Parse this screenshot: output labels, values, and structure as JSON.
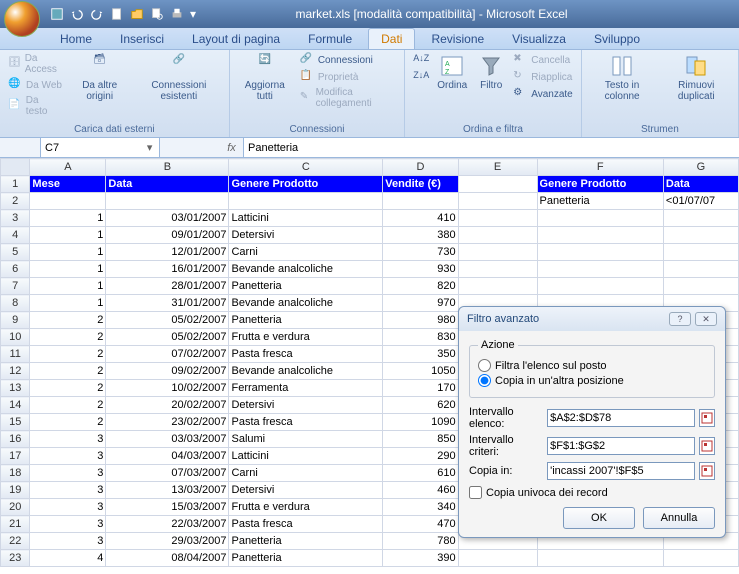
{
  "title": "market.xls [modalità compatibilità] - Microsoft Excel",
  "tabs": [
    "Home",
    "Inserisci",
    "Layout di pagina",
    "Formule",
    "Dati",
    "Revisione",
    "Visualizza",
    "Sviluppo"
  ],
  "active_tab": 4,
  "ribbon": {
    "g1": {
      "label": "Carica dati esterni",
      "items": [
        "Da Access",
        "Da Web",
        "Da testo"
      ],
      "btns": [
        "Da altre origini",
        "Connessioni esistenti"
      ]
    },
    "g2": {
      "label": "Connessioni",
      "btn": "Aggiorna tutti",
      "items": [
        "Connessioni",
        "Proprietà",
        "Modifica collegamenti"
      ]
    },
    "g3": {
      "label": "Ordina e filtra",
      "sort": "Ordina",
      "filter": "Filtro",
      "items": [
        "Cancella",
        "Riapplica",
        "Avanzate"
      ]
    },
    "g4": {
      "label": "Strumen",
      "btns": [
        "Testo in colonne",
        "Rimuovi duplicati"
      ]
    }
  },
  "namebox": "C7",
  "formula": "Panetteria",
  "columns": [
    "A",
    "B",
    "C",
    "D",
    "E",
    "F",
    "G"
  ],
  "headers": {
    "mese": "Mese",
    "data": "Data",
    "genere": "Genere Prodotto",
    "vendite": "Vendite (€)"
  },
  "criteria_headers": {
    "genere": "Genere Prodotto",
    "data": "Data"
  },
  "criteria": {
    "genere": "Panetteria",
    "data": "<01/07/07"
  },
  "rows": [
    {
      "m": 1,
      "d": "03/01/2007",
      "g": "Latticini",
      "v": 410
    },
    {
      "m": 1,
      "d": "09/01/2007",
      "g": "Detersivi",
      "v": 380
    },
    {
      "m": 1,
      "d": "12/01/2007",
      "g": "Carni",
      "v": 730
    },
    {
      "m": 1,
      "d": "16/01/2007",
      "g": "Bevande analcoliche",
      "v": 930
    },
    {
      "m": 1,
      "d": "28/01/2007",
      "g": "Panetteria",
      "v": 820
    },
    {
      "m": 1,
      "d": "31/01/2007",
      "g": "Bevande analcoliche",
      "v": 970
    },
    {
      "m": 2,
      "d": "05/02/2007",
      "g": "Panetteria",
      "v": 980
    },
    {
      "m": 2,
      "d": "05/02/2007",
      "g": "Frutta e verdura",
      "v": 830
    },
    {
      "m": 2,
      "d": "07/02/2007",
      "g": "Pasta fresca",
      "v": 350
    },
    {
      "m": 2,
      "d": "09/02/2007",
      "g": "Bevande analcoliche",
      "v": 1050
    },
    {
      "m": 2,
      "d": "10/02/2007",
      "g": "Ferramenta",
      "v": 170
    },
    {
      "m": 2,
      "d": "20/02/2007",
      "g": "Detersivi",
      "v": 620
    },
    {
      "m": 2,
      "d": "23/02/2007",
      "g": "Pasta fresca",
      "v": 1090
    },
    {
      "m": 3,
      "d": "03/03/2007",
      "g": "Salumi",
      "v": 850
    },
    {
      "m": 3,
      "d": "04/03/2007",
      "g": "Latticini",
      "v": 290
    },
    {
      "m": 3,
      "d": "07/03/2007",
      "g": "Carni",
      "v": 610
    },
    {
      "m": 3,
      "d": "13/03/2007",
      "g": "Detersivi",
      "v": 460
    },
    {
      "m": 3,
      "d": "15/03/2007",
      "g": "Frutta e verdura",
      "v": 340
    },
    {
      "m": 3,
      "d": "22/03/2007",
      "g": "Pasta fresca",
      "v": 470
    },
    {
      "m": 3,
      "d": "29/03/2007",
      "g": "Panetteria",
      "v": 780
    },
    {
      "m": 4,
      "d": "08/04/2007",
      "g": "Panetteria",
      "v": 390
    }
  ],
  "dialog": {
    "title": "Filtro avanzato",
    "azione": "Azione",
    "r1": "Filtra l'elenco sul posto",
    "r2": "Copia in un'altra posizione",
    "f1l": "Intervallo elenco:",
    "f1v": "$A$2:$D$78",
    "f2l": "Intervallo criteri:",
    "f2v": "$F$1:$G$2",
    "f3l": "Copia in:",
    "f3v": "'incassi 2007'!$F$5",
    "chk": "Copia univoca dei record",
    "ok": "OK",
    "cancel": "Annulla"
  }
}
